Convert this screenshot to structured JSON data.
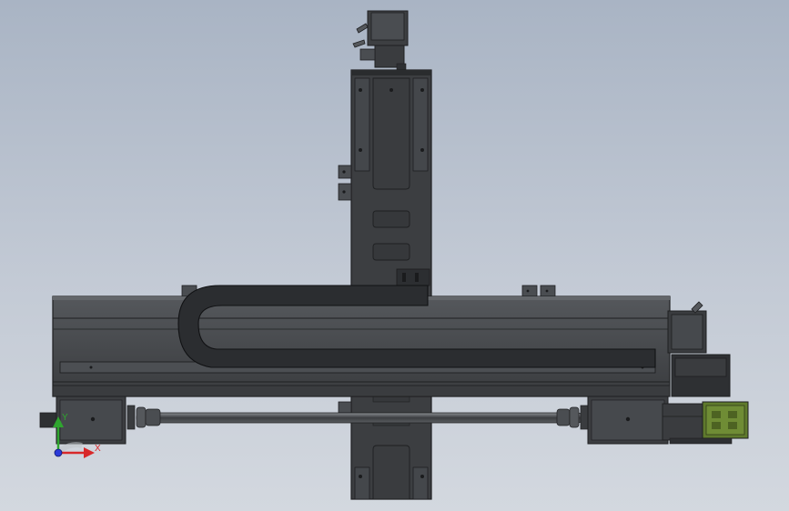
{
  "viewport": {
    "colors": {
      "background_top": "#a9b4c4",
      "background_bottom": "#d3d8df",
      "part_dark": "#3a3c3f",
      "part_mid": "#4d5054",
      "part_edge": "#1e1f21",
      "motor_green": "#5f7a2c",
      "accent_red": "#6e2a36"
    }
  },
  "triad": {
    "x_label": "X",
    "y_label": "Y",
    "x_color": "#d8282a",
    "y_color": "#2fa52f",
    "z_color": "#2a3ad8"
  }
}
